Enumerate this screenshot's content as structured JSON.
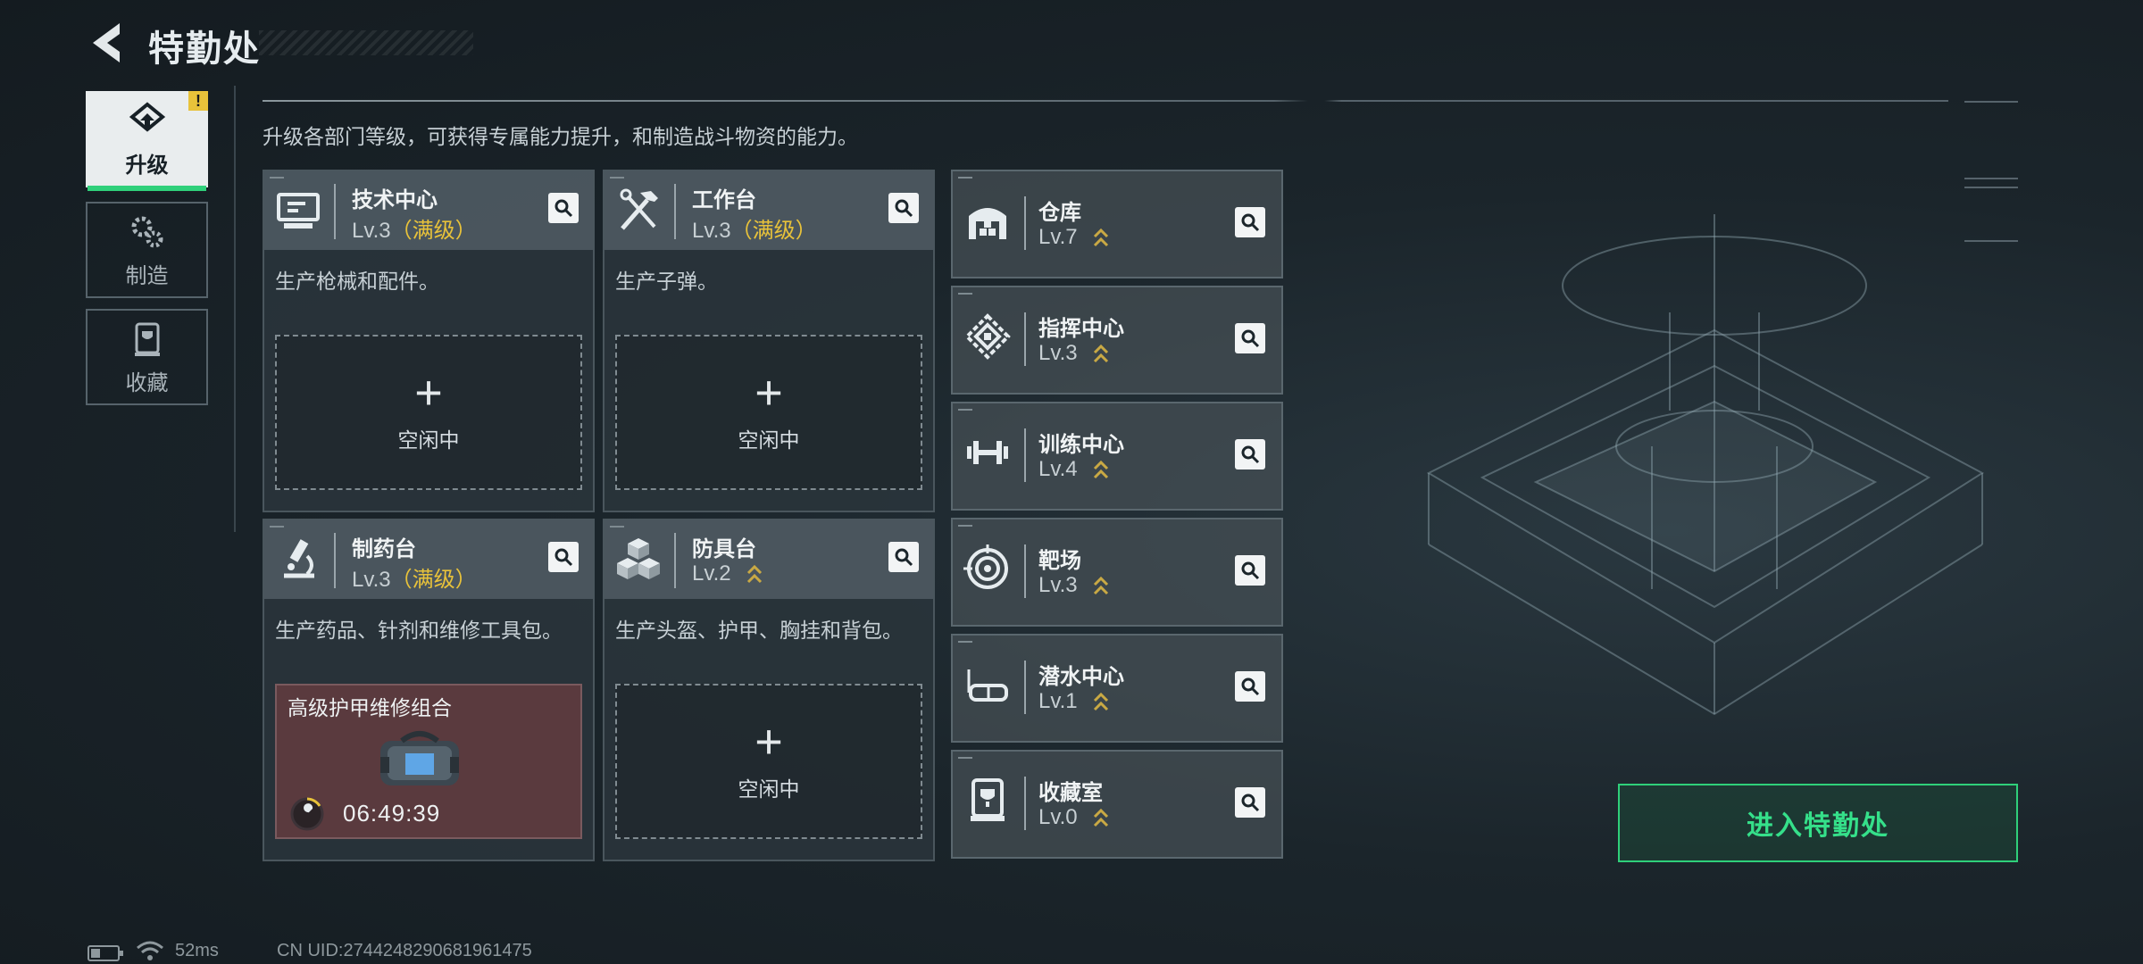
{
  "header": {
    "title": "特勤处"
  },
  "tabs": [
    {
      "label": "升级",
      "active": true,
      "icon": "upgrade-icon",
      "alert": "!"
    },
    {
      "label": "制造",
      "active": false,
      "icon": "gears-icon"
    },
    {
      "label": "收藏",
      "active": false,
      "icon": "collection-icon"
    }
  ],
  "description": "升级各部门等级，可获得专属能力提升，和制造战斗物资的能力。",
  "max_label": "（满级）",
  "cards": [
    {
      "name": "技术中心",
      "level": "Lv.3",
      "max": true,
      "desc": "生产枪械和配件。",
      "slot": "空闲中",
      "icon": "computer-icon"
    },
    {
      "name": "工作台",
      "level": "Lv.3",
      "max": true,
      "desc": "生产子弹。",
      "slot": "空闲中",
      "icon": "tools-icon"
    },
    {
      "name": "制药台",
      "level": "Lv.3",
      "max": true,
      "desc": "生产药品、针剂和维修工具包。",
      "icon": "microscope-icon",
      "crafting": {
        "item": "高级护甲维修组合",
        "timer": "06:49:39"
      }
    },
    {
      "name": "防具台",
      "level": "Lv.2",
      "max": false,
      "desc": "生产头盔、护甲、胸挂和背包。",
      "slot": "空闲中",
      "icon": "cubes-icon"
    }
  ],
  "facilities": [
    {
      "name": "仓库",
      "level": "Lv.7",
      "icon": "warehouse-icon"
    },
    {
      "name": "指挥中心",
      "level": "Lv.3",
      "icon": "command-icon"
    },
    {
      "name": "训练中心",
      "level": "Lv.4",
      "icon": "dumbbell-icon"
    },
    {
      "name": "靶场",
      "level": "Lv.3",
      "icon": "target-icon"
    },
    {
      "name": "潜水中心",
      "level": "Lv.1",
      "icon": "goggles-icon"
    },
    {
      "name": "收藏室",
      "level": "Lv.0",
      "icon": "trophy-case-icon"
    }
  ],
  "plus": "+",
  "enter_button": "进入特勤处",
  "status": {
    "ping": "52ms",
    "uid": "CN UID:2744248290681961475"
  },
  "colors": {
    "accent": "#2fd07a",
    "max": "#e8c23a",
    "background": "#1b252b"
  }
}
